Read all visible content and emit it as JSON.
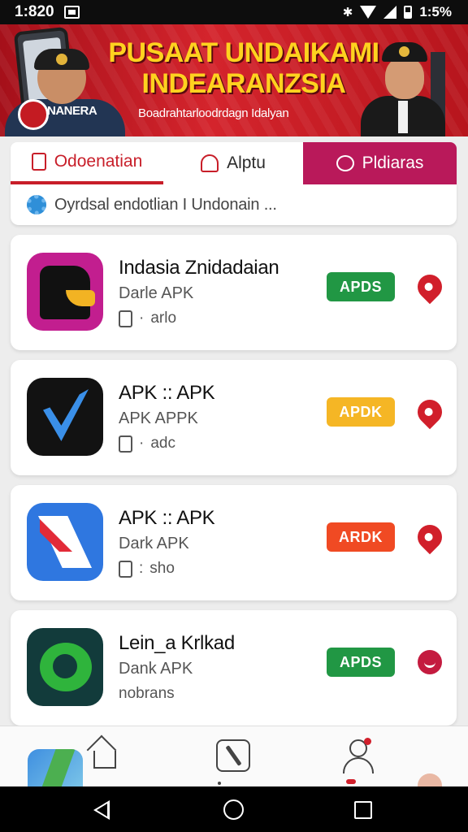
{
  "status_bar": {
    "time": "1:820",
    "battery_text": "1:5%"
  },
  "banner": {
    "title_line1": "PUSAAT UNDAIKAMI",
    "title_line2": "INDEARANZSIA",
    "subtitle": "Boadrahtarloodrdagn Idalyan",
    "logo_text": "NANERA"
  },
  "tabs": [
    {
      "label": "Odoenatian",
      "icon": "document-icon",
      "active": true
    },
    {
      "label": "Alptu",
      "icon": "bell-icon",
      "active": false
    },
    {
      "label": "Pldiaras",
      "icon": "chat-icon",
      "active": false
    }
  ],
  "search": {
    "text": "Oyrdsal endotlian I Undonain ..."
  },
  "apps": [
    {
      "name": "Indasia Znidadaian",
      "subtitle": "Darle APK",
      "meta": "arlo",
      "meta_icon": true,
      "button": "APDS",
      "button_color": "#219744",
      "action_icon": "heart-icon"
    },
    {
      "name": "APK :: APK",
      "subtitle": "APK APPK",
      "meta": "adc",
      "meta_icon": true,
      "button": "APDK",
      "button_color": "#f5b625",
      "action_icon": "heart-icon"
    },
    {
      "name": "APK :: APK",
      "subtitle": "Dark APK",
      "meta": "sho",
      "meta_icon": true,
      "button": "ARDK",
      "button_color": "#f04a23",
      "action_icon": "heart-icon"
    },
    {
      "name": "Lein_a Krlkad",
      "subtitle": "Dank APK",
      "meta": "nobrans",
      "meta_icon": false,
      "button": "APDS",
      "button_color": "#219744",
      "action_icon": "circle-icon"
    }
  ],
  "colors": {
    "accent_red": "#c81e29",
    "tab_magenta": "#b9195a",
    "banner_red": "#d4242c",
    "banner_title_yellow": "#ffd21f"
  }
}
